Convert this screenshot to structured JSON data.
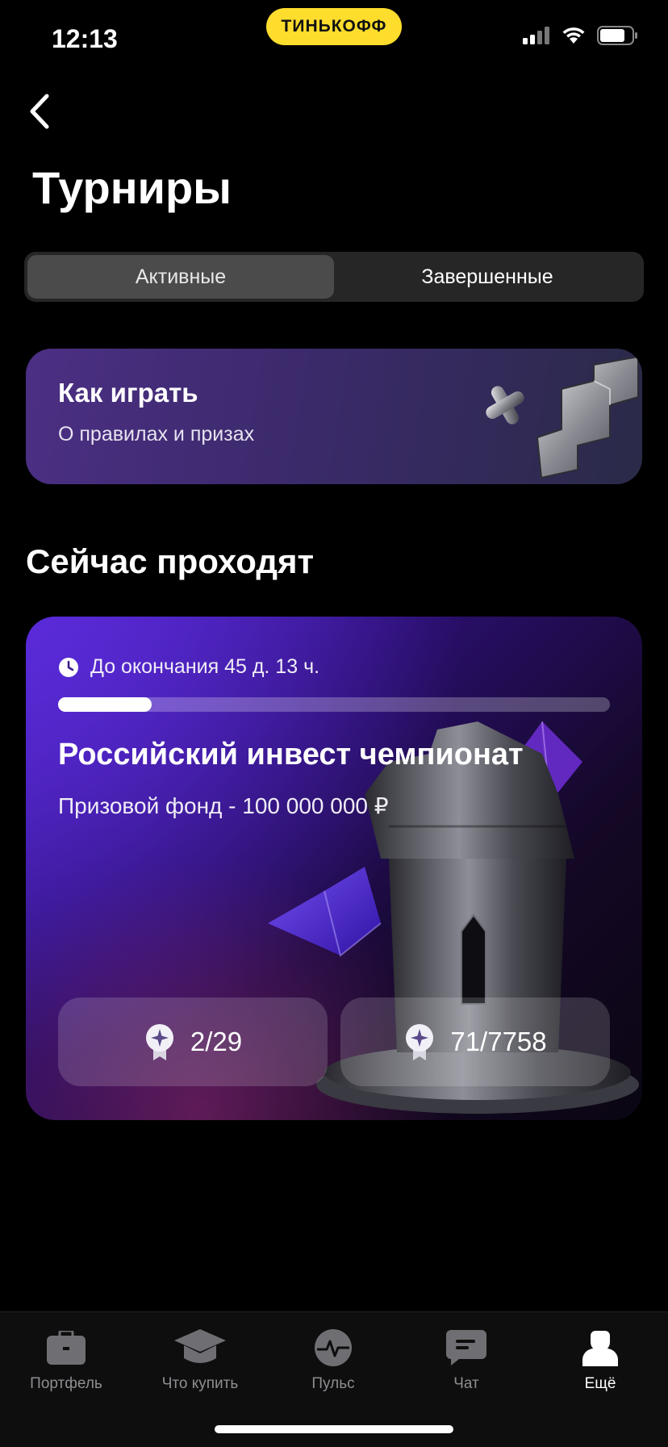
{
  "status_bar": {
    "time": "12:13",
    "brand": "ТИНЬКОФФ"
  },
  "page": {
    "title": "Турниры"
  },
  "segments": [
    {
      "label": "Активные",
      "active": true
    },
    {
      "label": "Завершенные",
      "active": false
    }
  ],
  "howto": {
    "title": "Как играть",
    "subtitle": "О правилах и призах"
  },
  "section": {
    "title": "Сейчас проходят"
  },
  "tournament": {
    "time_left": "До окончания 45 д. 13 ч.",
    "progress": 0.17,
    "title": "Российский инвест чемпионат",
    "prize": "Призовой фонд - 100 000 000 ₽",
    "stats": [
      {
        "icon": "medal-icon",
        "value": "2/29"
      },
      {
        "icon": "medal-icon",
        "value": "71/7758"
      }
    ]
  },
  "tabbar": {
    "items": [
      {
        "label": "Портфель",
        "icon": "briefcase-icon",
        "active": false
      },
      {
        "label": "Что купить",
        "icon": "graduation-cap-icon",
        "active": false
      },
      {
        "label": "Пульс",
        "icon": "pulse-icon",
        "active": false
      },
      {
        "label": "Чат",
        "icon": "chat-icon",
        "active": false
      },
      {
        "label": "Ещё",
        "icon": "profile-icon",
        "active": true
      }
    ]
  },
  "colors": {
    "brand_yellow": "#ffdd2d",
    "card_purple": "#4a1fc2"
  }
}
